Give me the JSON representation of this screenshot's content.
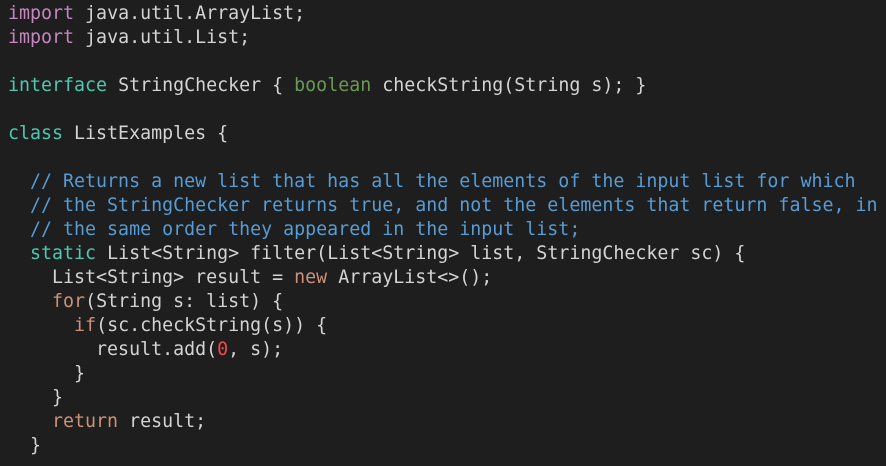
{
  "theme": {
    "background": "#1e1e1e",
    "text": "#d4d4d4",
    "import_keyword": "#c586c0",
    "declaration_keyword": "#4ec9b0",
    "boolean_keyword": "#6a9955",
    "comment": "#569cd6",
    "control_keyword": "#ce9178",
    "number_literal": "#f44747"
  },
  "lines": [
    [
      {
        "cls": "t-keyword",
        "text": "import"
      },
      {
        "cls": "t-plain",
        "text": " java.util.ArrayList;"
      }
    ],
    [
      {
        "cls": "t-keyword",
        "text": "import"
      },
      {
        "cls": "t-plain",
        "text": " java.util.List;"
      }
    ],
    [],
    [
      {
        "cls": "t-prim",
        "text": "interface"
      },
      {
        "cls": "t-plain",
        "text": " StringChecker { "
      },
      {
        "cls": "t-green",
        "text": "boolean"
      },
      {
        "cls": "t-plain",
        "text": " checkString(String s); }"
      }
    ],
    [],
    [
      {
        "cls": "t-prim",
        "text": "class"
      },
      {
        "cls": "t-plain",
        "text": " ListExamples {"
      }
    ],
    [],
    [
      {
        "cls": "t-comment",
        "text": "  // Returns a new list that has all the elements of the input list for which"
      }
    ],
    [
      {
        "cls": "t-comment",
        "text": "  // the StringChecker returns true, and not the elements that return false, in"
      }
    ],
    [
      {
        "cls": "t-comment",
        "text": "  // the same order they appeared in the input list;"
      }
    ],
    [
      {
        "cls": "t-plain",
        "text": "  "
      },
      {
        "cls": "t-prim",
        "text": "static"
      },
      {
        "cls": "t-plain",
        "text": " List<String> filter(List<String> list, StringChecker sc) {"
      }
    ],
    [
      {
        "cls": "t-plain",
        "text": "    List<String> result = "
      },
      {
        "cls": "t-orange",
        "text": "new"
      },
      {
        "cls": "t-plain",
        "text": " ArrayList<>();"
      }
    ],
    [
      {
        "cls": "t-plain",
        "text": "    "
      },
      {
        "cls": "t-orange",
        "text": "for"
      },
      {
        "cls": "t-plain",
        "text": "(String s: list) {"
      }
    ],
    [
      {
        "cls": "t-plain",
        "text": "      "
      },
      {
        "cls": "t-orange",
        "text": "if"
      },
      {
        "cls": "t-plain",
        "text": "(sc.checkString(s)) {"
      }
    ],
    [
      {
        "cls": "t-plain",
        "text": "        result.add("
      },
      {
        "cls": "t-number",
        "text": "0"
      },
      {
        "cls": "t-plain",
        "text": ", s);"
      }
    ],
    [
      {
        "cls": "t-plain",
        "text": "      }"
      }
    ],
    [
      {
        "cls": "t-plain",
        "text": "    }"
      }
    ],
    [
      {
        "cls": "t-plain",
        "text": "    "
      },
      {
        "cls": "t-orange",
        "text": "return"
      },
      {
        "cls": "t-plain",
        "text": " result;"
      }
    ],
    [
      {
        "cls": "t-plain",
        "text": "  }"
      }
    ]
  ]
}
